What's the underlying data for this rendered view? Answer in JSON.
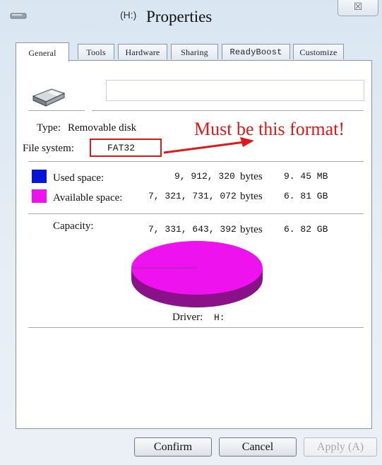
{
  "window": {
    "drive_label": "(H:)",
    "title": "Properties",
    "close_glyph": "☒"
  },
  "tabs": [
    {
      "label": "General",
      "active": true
    },
    {
      "label": "Tools",
      "active": false
    },
    {
      "label": "Hardware",
      "active": false
    },
    {
      "label": "Sharing",
      "active": false
    },
    {
      "label": "ReadyBoost",
      "active": false
    },
    {
      "label": "Customize",
      "active": false
    }
  ],
  "general": {
    "drive_icon": "usb-drive-icon",
    "name_value": "",
    "type_label": "Type:",
    "type_value": "Removable disk",
    "fs_label": "File system:",
    "fs_value": "FAT32",
    "annotation": "Must be this format!"
  },
  "space": {
    "used": {
      "label": "Used space:",
      "bytes": "9, 912, 320",
      "unit": "bytes",
      "size": "9. 45 MB",
      "color": "#0a14d8"
    },
    "available": {
      "label": "Available space:",
      "bytes": "7, 321, 731, 072",
      "unit": "bytes",
      "size": "6. 81 GB",
      "color": "#ee12ee"
    },
    "capacity": {
      "label": "Capacity:",
      "bytes": "7, 331, 643, 392",
      "unit": "bytes",
      "size": "6. 82 GB"
    }
  },
  "pie": {
    "used_fraction": 0.0014,
    "top_color": "#ee12ee",
    "side_color": "#8a1289"
  },
  "driver": {
    "label": "Driver:",
    "letter": "H:"
  },
  "buttons": {
    "confirm": "Confirm",
    "cancel": "Cancel",
    "apply": "Apply (A)"
  }
}
